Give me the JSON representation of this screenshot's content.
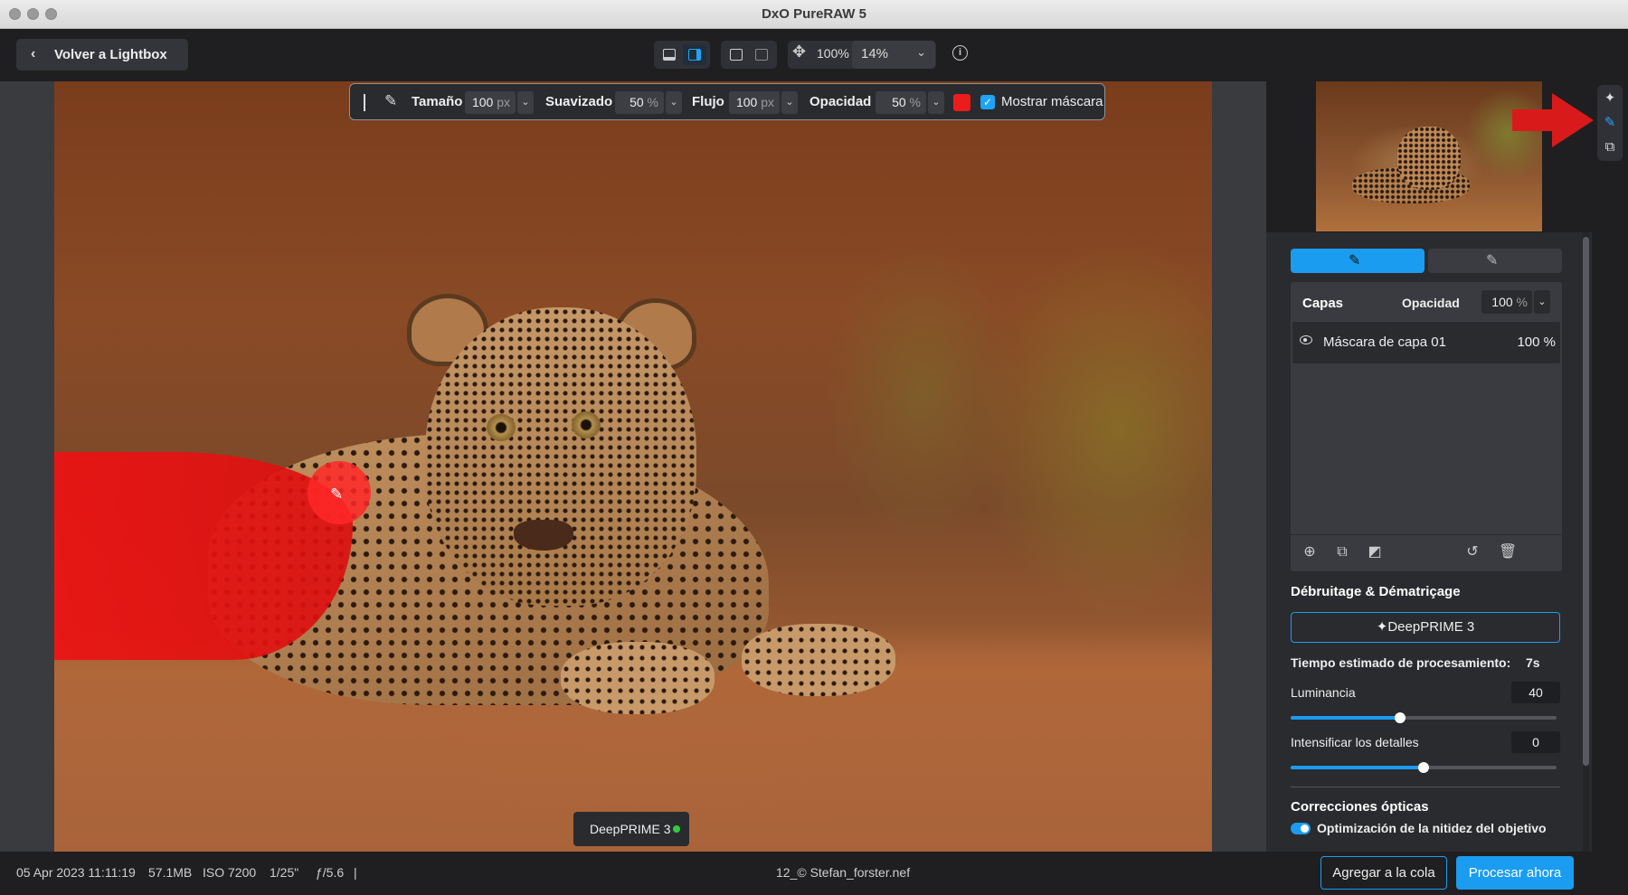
{
  "window": {
    "title": "DxO PureRAW 5"
  },
  "toolbar": {
    "back_label": "Volver a Lightbox",
    "zoom_fit": "100%",
    "zoom_value": "14%"
  },
  "brush": {
    "size_label": "Tamaño",
    "size_value": "100",
    "size_unit": "px",
    "feather_label": "Suavizado",
    "feather_value": "50",
    "feather_unit": "%",
    "flow_label": "Flujo",
    "flow_value": "100",
    "flow_unit": "px",
    "opacity_label": "Opacidad",
    "opacity_value": "50",
    "opacity_unit": "%",
    "mask_color": "#ec1c1c",
    "show_mask_label": "Mostrar máscara",
    "show_mask_checked": true
  },
  "canvas": {
    "badge_label": "DeepPRIME 3"
  },
  "layers": {
    "title": "Capas",
    "opacity_label": "Opacidad",
    "opacity_value": "100",
    "opacity_unit": "%",
    "items": [
      {
        "name": "Máscara de capa 01",
        "opacity": "100 %"
      }
    ]
  },
  "denoise": {
    "section_title": "Débruitage & Dématriçage",
    "method_button": "✦DeepPRIME 3",
    "estimate_label": "Tiempo estimado de procesamiento:",
    "estimate_value": "7s",
    "luminance_label": "Luminancia",
    "luminance_value": "40",
    "luminance_fraction": 0.41,
    "details_label": "Intensificar los detalles",
    "details_value": "0",
    "details_fraction": 0.5
  },
  "optics": {
    "section_title": "Correcciones ópticas",
    "sharpness_label": "Optimización de la nitidez del objetivo",
    "sharpness_on": true
  },
  "status": {
    "date": "05 Apr 2023 11:11:19",
    "size": "57.1MB",
    "iso": "ISO 7200",
    "shutter": "1/25\"",
    "aperture": "ƒ/5.6",
    "separator": "|",
    "filename": "12_© Stefan_forster.nef",
    "queue_label": "Agregar a la cola",
    "process_label": "Procesar ahora"
  },
  "colors": {
    "accent": "#1a9cf0",
    "annotation_arrow": "#d91a1a"
  }
}
